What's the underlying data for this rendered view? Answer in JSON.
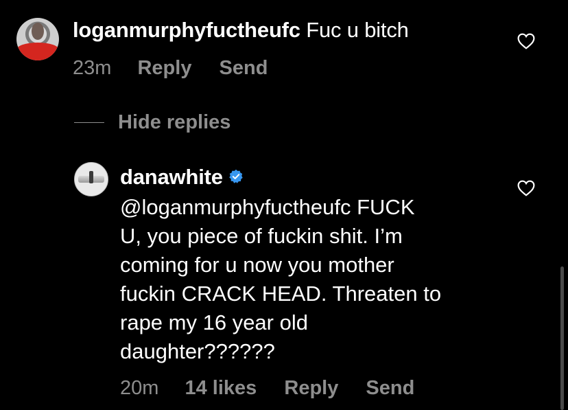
{
  "comment": {
    "username": "loganmurphyfuctheufc",
    "text": "Fuc u bitch",
    "time": "23m",
    "reply_label": "Reply",
    "send_label": "Send"
  },
  "replies_toggle": {
    "label": "Hide replies"
  },
  "reply": {
    "username": "danawhite",
    "verified": true,
    "text": "@loganmurphyfuctheufc FUCK\nU, you piece of fuckin shit. I’m\ncoming for u now you mother\nfuckin CRACK HEAD. Threaten to\nrape my 16 year old\ndaughter??????",
    "time": "20m",
    "likes": "14 likes",
    "reply_label": "Reply",
    "send_label": "Send"
  },
  "colors": {
    "background": "#000000",
    "primary_text": "#ffffff",
    "secondary_text": "#8e8e8e",
    "verified_badge": "#3897f0"
  },
  "icons": {
    "like": "heart-outline-icon",
    "verified": "verified-badge-icon"
  }
}
